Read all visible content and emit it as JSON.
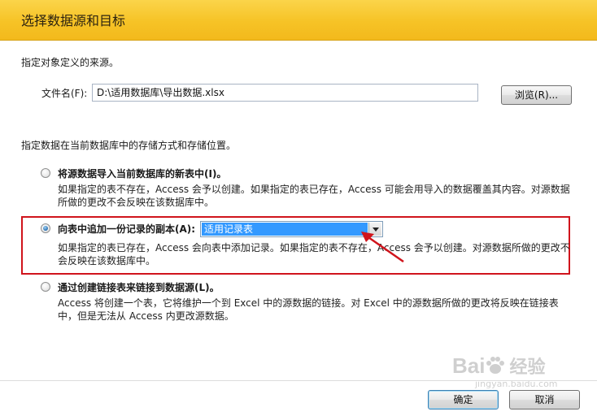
{
  "dialog": {
    "title": "选择数据源和目标"
  },
  "source": {
    "instruction": "指定对象定义的来源。",
    "file_label": "文件名(F):",
    "file_value": "D:\\适用数据库\\导出数据.xlsx",
    "browse_label": "浏览(R)..."
  },
  "storage": {
    "instruction": "指定数据在当前数据库中的存储方式和存储位置。",
    "options": [
      {
        "label": "将源数据导入当前数据库的新表中(I)。",
        "description_line1": "如果指定的表不存在，Access 会予以创建。如果指定的表已存在，Access 可能会用导入的数据覆盖其内容。对源数据",
        "description_line2": "所做的更改不会反映在该数据库中。",
        "selected": false
      },
      {
        "label": "向表中追加一份记录的副本(A):",
        "selected_table": "适用记录表",
        "description_line1": "如果指定的表已存在，Access 会向表中添加记录。如果指定的表不存在，Access 会予以创建。对源数据所做的更改不",
        "description_line2": "会反映在该数据库中。",
        "selected": true
      },
      {
        "label": "通过创建链接表来链接到数据源(L)。",
        "description_line1": "Access 将创建一个表，它将维护一个到 Excel 中的源数据的链接。对 Excel 中的源数据所做的更改将反映在链接表",
        "description_line2": "中，但是无法从 Access 内更改源数据。",
        "selected": false
      }
    ]
  },
  "footer": {
    "ok_label": "确定",
    "cancel_label": "取消"
  },
  "watermark": {
    "brand": "Bai",
    "suffix": "经验",
    "url": "jingyan.baidu.com"
  },
  "colors": {
    "header": "#f6c326",
    "highlight_box": "#d0141c",
    "selection": "#3399ff"
  }
}
